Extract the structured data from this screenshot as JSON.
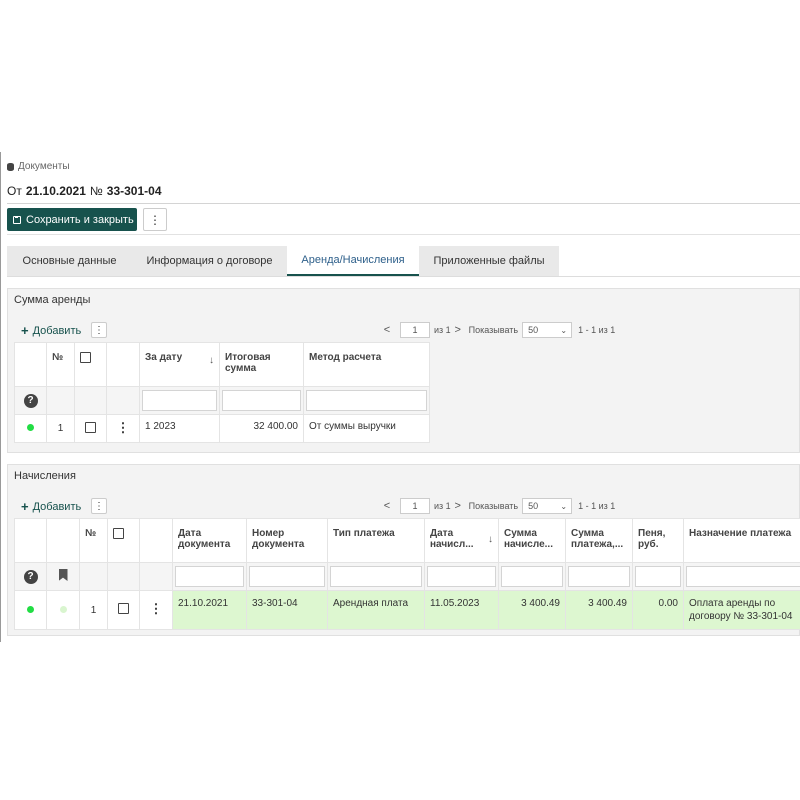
{
  "breadcrumb": {
    "icon": "database-icon",
    "label": "Документы"
  },
  "header": {
    "prefix": "От",
    "date": "21.10.2021",
    "number_sign": "№",
    "number": "33-301-04"
  },
  "toolbar": {
    "save_label": "Сохранить и закрыть",
    "more_label": "⋮"
  },
  "tabs": [
    {
      "label": "Основные данные"
    },
    {
      "label": "Информация о договоре"
    },
    {
      "label": "Аренда/Начисления",
      "active": true
    },
    {
      "label": "Приложенные файлы"
    }
  ],
  "rent": {
    "title": "Сумма аренды",
    "add_label": "Добавить",
    "pager": {
      "prev": "<",
      "page": "1",
      "of": "из 1",
      "next": ">",
      "show_label": "Показывать",
      "page_size": "50",
      "range": "1 - 1 из 1"
    },
    "columns": {
      "num": "№",
      "date": "За дату",
      "total": "Итоговая сумма",
      "method": "Метод расчета"
    },
    "rows": [
      {
        "num": "1",
        "date": "1 2023",
        "total": "32 400.00",
        "method": "От суммы выручки"
      }
    ]
  },
  "charges": {
    "title": "Начисления",
    "add_label": "Добавить",
    "pager": {
      "prev": "<",
      "page": "1",
      "of": "из 1",
      "next": ">",
      "show_label": "Показывать",
      "page_size": "50",
      "range": "1 - 1 из 1"
    },
    "columns": {
      "num": "№",
      "doc_date": "Дата документа",
      "doc_number": "Номер документа",
      "payment_type": "Тип платежа",
      "charge_date": "Дата начисл...",
      "charge_sum": "Сумма начисле...",
      "payment_sum": "Сумма платежа,...",
      "penalty": "Пеня, руб.",
      "purpose": "Назначение платежа"
    },
    "rows": [
      {
        "num": "1",
        "doc_date": "21.10.2021",
        "doc_number": "33-301-04",
        "payment_type": "Арендная плата",
        "charge_date": "11.05.2023",
        "charge_sum": "3 400.49",
        "payment_sum": "3 400.49",
        "penalty": "0.00",
        "purpose": "Оплата аренды по договору № 33-301-04"
      }
    ]
  },
  "colors": {
    "primary": "#17524d",
    "status_green": "#22dd44",
    "status_light": "#d9f5cf",
    "row_highlight": "#ddf7d0"
  }
}
